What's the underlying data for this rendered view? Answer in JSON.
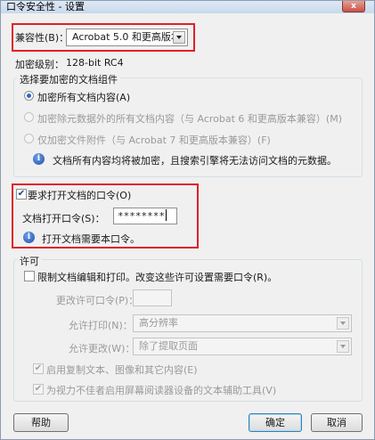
{
  "window": {
    "title": "口令安全性 - 设置",
    "close_glyph": "x"
  },
  "compatibility": {
    "label": "兼容性(B)：",
    "selected": "Acrobat 5.0 和更高版本"
  },
  "encryption_level": {
    "label": "加密级别：",
    "value": "128-bit RC4"
  },
  "components_group": {
    "title": "选择要加密的文档组件",
    "options": [
      {
        "label": "加密所有文档内容(A)",
        "checked": true,
        "enabled": true
      },
      {
        "label": "加密除元数据外的所有文档内容（与 Acrobat 6 和更高版本兼容）(M)",
        "checked": false,
        "enabled": false
      },
      {
        "label": "仅加密文件附件（与 Acrobat 7 和更高版本兼容）(F)",
        "checked": false,
        "enabled": false
      }
    ],
    "info_text": "文档所有内容均将被加密，且搜索引擎将无法访问文档的元数据。"
  },
  "open_password": {
    "checkbox_label": "要求打开文档的口令(O)",
    "checked": true,
    "field_label": "文档打开口令(S)：",
    "field_value": "********",
    "info_text": "打开文档需要本口令。"
  },
  "permissions_group": {
    "title": "许可",
    "restrict_label": "限制文档编辑和打印。改变这些许可设置需要口令(R)。",
    "restrict_checked": false,
    "change_password_label": "更改许可口令(P)：",
    "change_password_value": "",
    "print_label": "允许打印(N)：",
    "print_value": "高分辨率",
    "changes_label": "允许更改(W)：",
    "changes_value": "除了提取页面",
    "copy_label": "启用复制文本、图像和其它内容(E)",
    "copy_checked": true,
    "screenreader_label": "为视力不佳者启用屏幕阅读器设备的文本辅助工具(V)",
    "screenreader_checked": true
  },
  "buttons": {
    "help": "帮助",
    "ok": "确定",
    "cancel": "取消"
  },
  "colors": {
    "highlight_box": "#e0202a",
    "dialog_bg": "#f0f0f0",
    "info_icon": "#1d4fa8"
  }
}
